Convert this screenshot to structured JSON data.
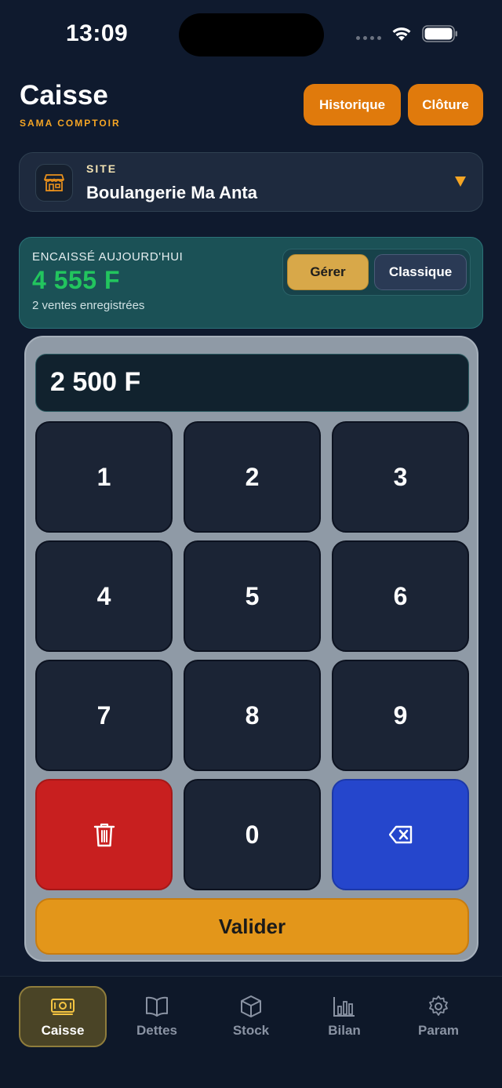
{
  "status_bar": {
    "time": "13:09"
  },
  "header": {
    "title": "Caisse",
    "subtitle": "SAMA COMPTOIR",
    "historique_label": "Historique",
    "cloture_label": "Clôture"
  },
  "site": {
    "label": "SITE",
    "name": "Boulangerie Ma Anta",
    "icon": "store-icon"
  },
  "summary": {
    "label": "ENCAISSÉ AUJOURD'HUI",
    "amount": "4 555 F",
    "sales_count": "2 ventes enregistrées",
    "mode_options": [
      "Gérer",
      "Classique"
    ],
    "selected_mode": "Gérer"
  },
  "keypad": {
    "display_value": "2 500 F",
    "keys": [
      "1",
      "2",
      "3",
      "4",
      "5",
      "6",
      "7",
      "8",
      "9",
      "0"
    ],
    "clear_icon": "trash-icon",
    "backspace_icon": "backspace-icon",
    "validate_label": "Valider"
  },
  "tabs": [
    {
      "label": "Caisse",
      "icon": "banknote-icon",
      "active": true
    },
    {
      "label": "Dettes",
      "icon": "book-icon",
      "active": false
    },
    {
      "label": "Stock",
      "icon": "box-icon",
      "active": false
    },
    {
      "label": "Bilan",
      "icon": "bar-chart-icon",
      "active": false
    },
    {
      "label": "Param",
      "icon": "gear-icon",
      "active": false
    }
  ],
  "colors": {
    "background": "#0f1a2e",
    "accent_orange": "#e07a0c",
    "amount_green": "#22c55e",
    "clear_red": "#c81f1f",
    "backspace_blue": "#2546cc",
    "validate_orange": "#e3961a"
  }
}
